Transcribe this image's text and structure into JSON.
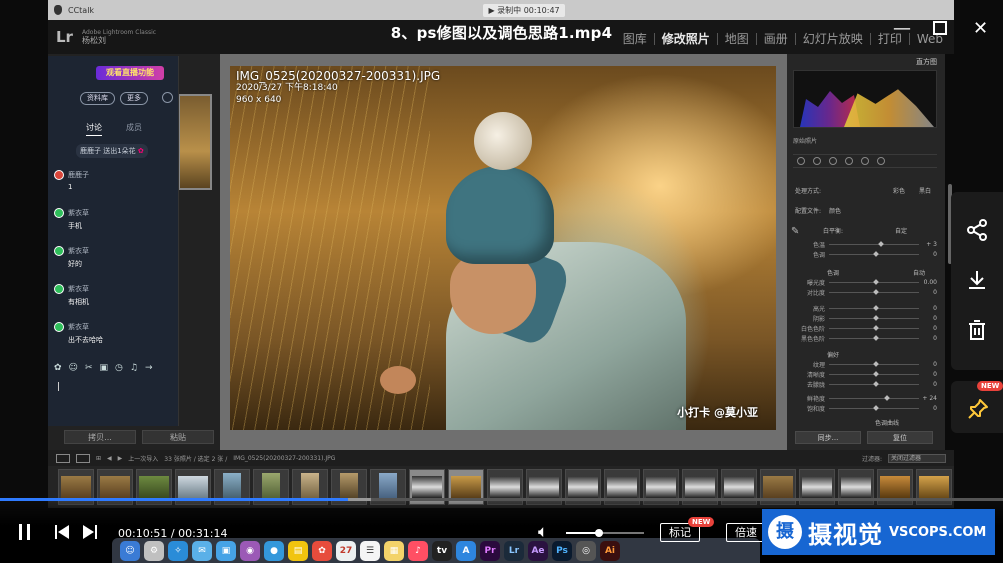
{
  "video": {
    "title": "8、ps修图以及调色思路1.mp4",
    "current_time": "00:10:51",
    "total_time": "00:31:14",
    "progress": 0.347,
    "buffered": 0.37,
    "volume": 0.42,
    "notes_label": "标记",
    "speed_label": "倍速",
    "new_badge": "NEW"
  },
  "mac_menubar": {
    "app": "CCtalk",
    "clock": "▶ 录制中 00:10:47"
  },
  "lightroom": {
    "logo": "Lr",
    "brand_line": "Adobe Lightroom Classic",
    "user": "杨松刘",
    "modules": [
      "图库",
      "修改照片",
      "地图",
      "画册",
      "幻灯片放映",
      "打印",
      "Web"
    ],
    "active_module": "修改照片",
    "left_buttons": [
      "拷贝...",
      "粘贴"
    ],
    "right_buttons": [
      "同步...",
      "复位"
    ],
    "photo": {
      "filename": "IMG_0525(20200327-200331).JPG",
      "date": "2020/3/27 下午8:18:40",
      "size": "960 x 640",
      "watermark": "小打卡 @莫小亚"
    },
    "histogram_title": "直方图",
    "original_photo": "原始照片",
    "basic": {
      "treatment_label": "处理方式:",
      "treatment_color": "彩色",
      "treatment_bw": "黑白",
      "profile_label": "配置文件:",
      "profile_value": "颜色",
      "wb_label": "白平衡:",
      "wb_value": "自定",
      "tone_label": "色调",
      "tone_auto": "自动",
      "presence_label": "偏好",
      "tone_curve": "色调曲线",
      "sliders": [
        {
          "label": "色温",
          "value": "+ 3"
        },
        {
          "label": "色调",
          "value": "0"
        },
        {
          "label": "曝光度",
          "value": "0.00"
        },
        {
          "label": "对比度",
          "value": "0"
        },
        {
          "label": "高光",
          "value": "0"
        },
        {
          "label": "阴影",
          "value": "0"
        },
        {
          "label": "白色色阶",
          "value": "0"
        },
        {
          "label": "黑色色阶",
          "value": "0"
        },
        {
          "label": "纹理",
          "value": "0"
        },
        {
          "label": "清晰度",
          "value": "0"
        },
        {
          "label": "去朦胧",
          "value": "0"
        },
        {
          "label": "鲜艳度",
          "value": "+ 24"
        },
        {
          "label": "饱和度",
          "value": "0"
        }
      ]
    },
    "filmstrip_bar": {
      "nav": "上一次导入",
      "count": "33 张照片 / 选定 2 张 /",
      "file": "IMG_0525(20200327-200331).JPG",
      "filter_label": "过滤器:",
      "filter_value": "关闭过滤器"
    }
  },
  "chat": {
    "banner": "观看直播功能",
    "btn_library": "资料库",
    "btn_more": "更多",
    "tab_discuss": "讨论",
    "tab_members": "成员",
    "notice": "鹿鹿子 送出1朵花",
    "messages": [
      {
        "name": "鹿鹿子",
        "text": "1"
      },
      {
        "name": "紫衣草",
        "text": "手机"
      },
      {
        "name": "紫衣草",
        "text": "好的"
      },
      {
        "name": "紫衣草",
        "text": "有相机"
      },
      {
        "name": "紫衣草",
        "text": "出不去哈哈"
      }
    ]
  },
  "logo": {
    "cn": "摄视觉",
    "en": "VSCOPS.COM",
    "mark": "摄"
  },
  "colors": {
    "progress": "#2f7bff",
    "badge": "#e8423b",
    "logo_bg": "#1766d2"
  },
  "icons": [
    "share-icon",
    "download-icon",
    "trash-icon",
    "pin-icon",
    "play-pause-icon",
    "prev-icon",
    "next-icon",
    "volume-icon",
    "close-icon",
    "maximize-icon",
    "minimize-icon"
  ]
}
